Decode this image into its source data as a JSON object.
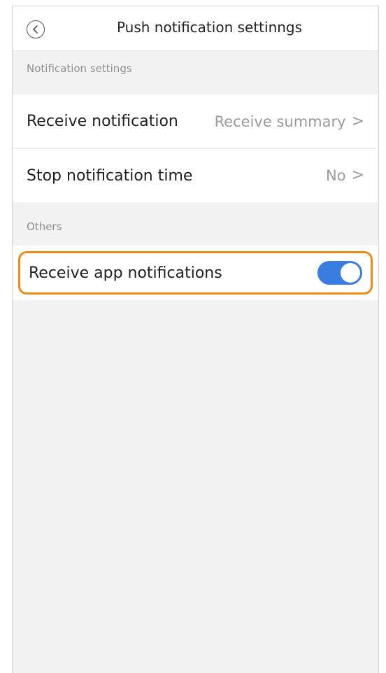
{
  "header": {
    "title": "Push notification settinngs",
    "back_icon": "chevron-left-circle-icon"
  },
  "sections": {
    "notification": {
      "label": "Notification settings",
      "rows": [
        {
          "label": "Receive notification",
          "value": "Receive summary",
          "chevron": ">"
        },
        {
          "label": "Stop notification time",
          "value": "No",
          "chevron": ">"
        }
      ]
    },
    "others": {
      "label": "Others",
      "rows": [
        {
          "label": "Receive app notifications",
          "toggle_on": true
        }
      ]
    }
  },
  "colors": {
    "highlight": "#f08a12",
    "toggle_on": "#3a7de0",
    "background": "#f2f2f2"
  }
}
